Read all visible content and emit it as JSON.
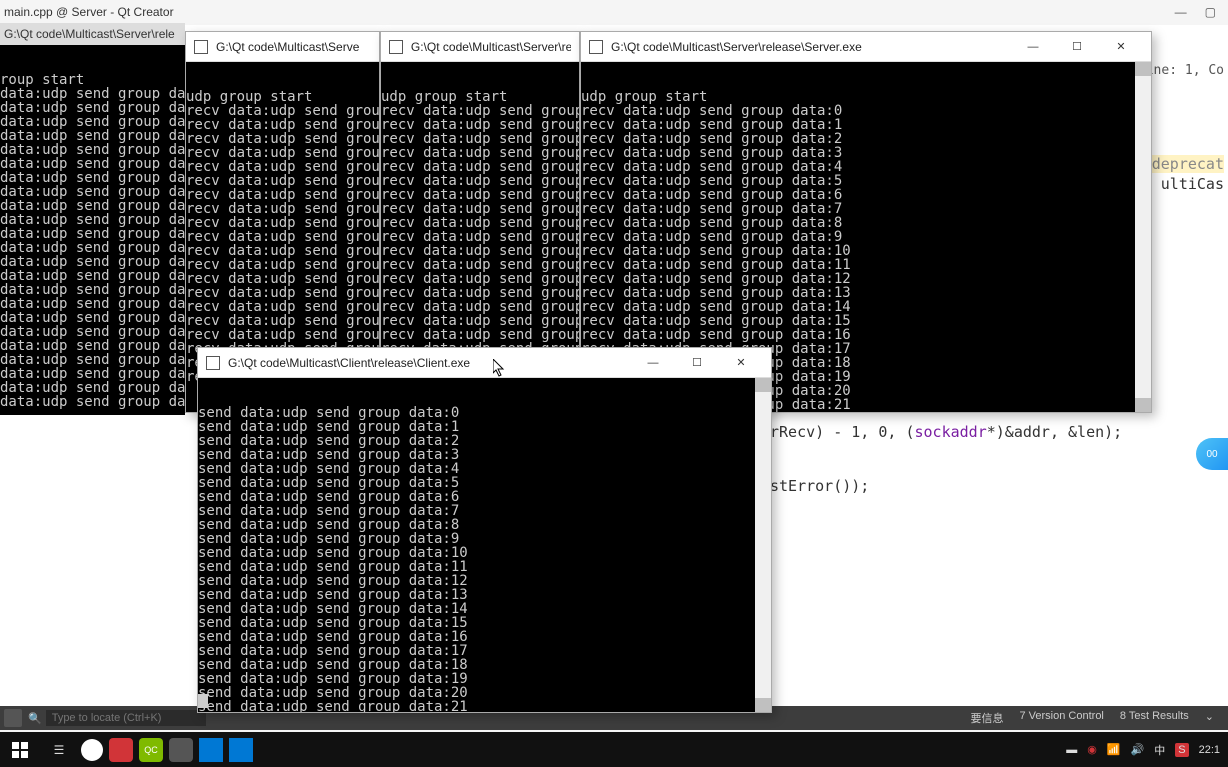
{
  "qtcreator": {
    "title": "main.cpp @ Server - Qt Creator",
    "locator_placeholder": "Type to locate (Ctrl+K)",
    "status_items": [
      "要信息",
      "7 Version Control",
      "8 Test Results"
    ],
    "line_info": "Line: 1, Co",
    "code_right_1": "deprecat",
    "code_right_2": "ultiCas",
    "code_mid_1": "rRecv) - 1, 0, (sockaddr*)&addr, &len);",
    "code_mid_2": "stError());"
  },
  "server_windows": {
    "title_full": "G:\\Qt code\\Multicast\\Server\\release\\Server.exe",
    "title_cut1": "G:\\Qt code\\Multicast\\Serve",
    "title_cut2": "G:\\Qt code\\Multicast\\Server\\re",
    "title_bg_path": "G:\\Qt code\\Multicast\\Server\\rele",
    "header_line": "udp group start",
    "header_line_broken": "roup start",
    "line_prefix_a": "data:udp send group data:",
    "line_prefix_b": "recv data:udp send group dat",
    "line_prefix_c": "recv data:udp send group data:",
    "count": 23
  },
  "client_window": {
    "title": "G:\\Qt code\\Multicast\\Client\\release\\Client.exe",
    "line_prefix": "send data:udp send group data:",
    "count": 23
  },
  "taskbar": {
    "time": "22:1"
  },
  "rec_badge": "00"
}
